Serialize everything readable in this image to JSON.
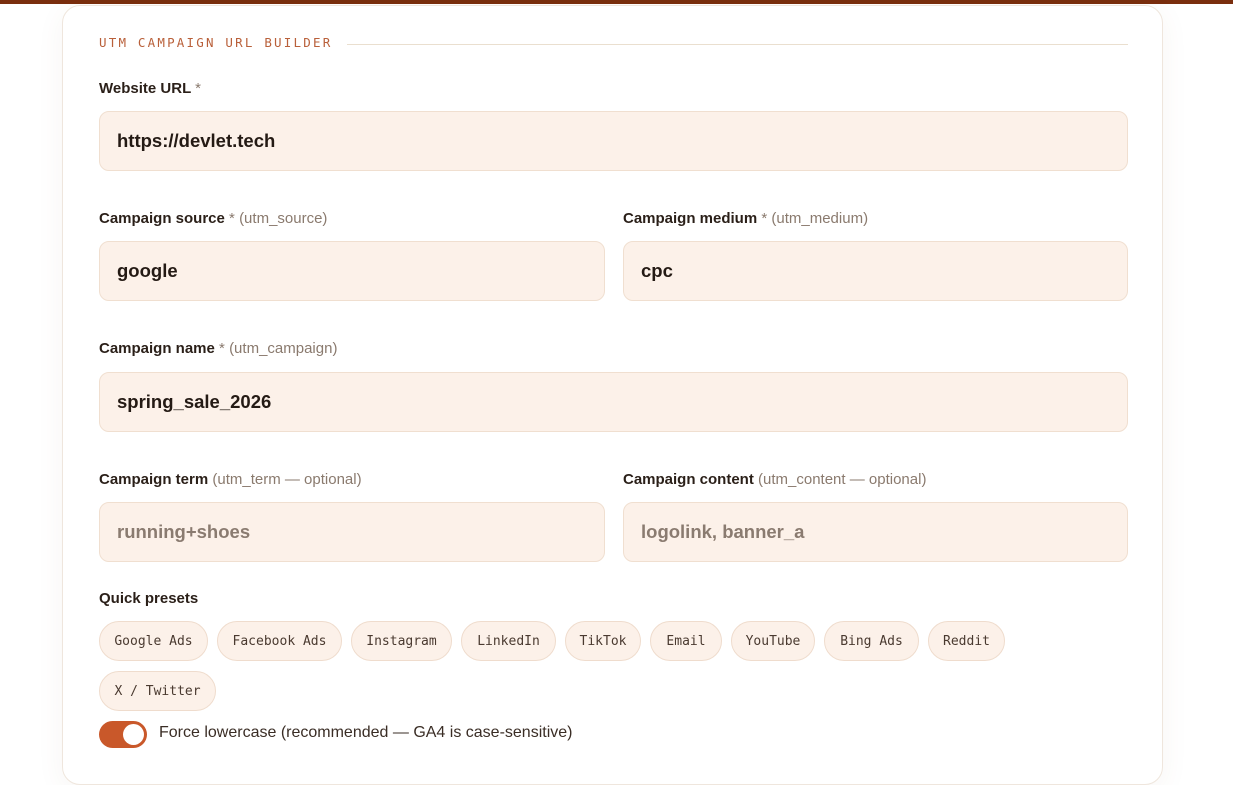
{
  "header": {
    "title": "UTM CAMPAIGN URL BUILDER"
  },
  "form": {
    "website_url": {
      "label": "Website URL",
      "required": "*",
      "value": "https://devlet.tech"
    },
    "source": {
      "label": "Campaign source",
      "required": "*",
      "hint": "(utm_source)",
      "value": "google"
    },
    "medium": {
      "label": "Campaign medium",
      "required": "*",
      "hint": "(utm_medium)",
      "value": "cpc"
    },
    "name": {
      "label": "Campaign name",
      "required": "*",
      "hint": "(utm_campaign)",
      "value": "spring_sale_2026"
    },
    "term": {
      "label": "Campaign term",
      "hint": "(utm_term — optional)",
      "placeholder": "running+shoes"
    },
    "content": {
      "label": "Campaign content",
      "hint": "(utm_content — optional)",
      "placeholder": "logolink, banner_a"
    }
  },
  "presets": {
    "label": "Quick presets",
    "items": [
      "Google Ads",
      "Facebook Ads",
      "Instagram",
      "LinkedIn",
      "TikTok",
      "Email",
      "YouTube",
      "Bing Ads",
      "Reddit",
      "X / Twitter"
    ]
  },
  "options": {
    "force_lowercase": {
      "label": "Force lowercase (recommended — GA4 is case-sensitive)",
      "checked": true
    }
  },
  "colors": {
    "accent": "#c9582a",
    "top_bar": "#7a2e0e",
    "field_bg": "#fcf1e9",
    "section_title": "#b9603a"
  }
}
